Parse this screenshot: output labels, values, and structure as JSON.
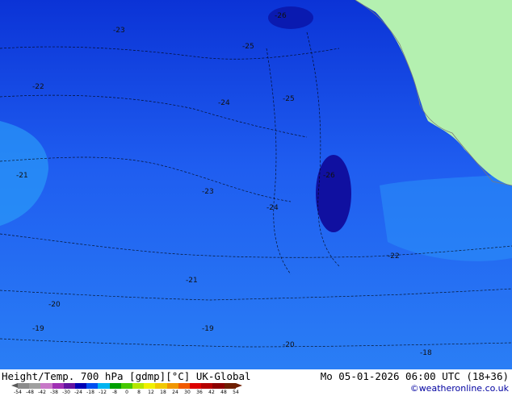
{
  "map": {
    "colors": {
      "sea_dark": "#0a32d8",
      "sea_mid": "#1e5cf0",
      "sea_light": "#2a8ef8",
      "core": "#1010a0",
      "land": "#b4f0b0",
      "contour": "#000000"
    },
    "contour_labels": [
      "-26",
      "-25",
      "-24",
      "-23",
      "-22",
      "-21",
      "-20",
      "-19",
      "-18"
    ]
  },
  "footer": {
    "caption_left": "Height/Temp. 700 hPa [gdmp][°C] UK-Global",
    "caption_right": "Mo 05-01-2026 06:00 UTC (18+36)",
    "credit": "©weatheronline.co.uk",
    "scale_labels": [
      "-54",
      "-48",
      "-42",
      "-38",
      "-30",
      "-24",
      "-18",
      "-12",
      "-8",
      "0",
      "8",
      "12",
      "18",
      "24",
      "30",
      "36",
      "42",
      "48",
      "54"
    ],
    "scale_colors": [
      "#8c8c8c",
      "#a0a0a0",
      "#c878c8",
      "#a030b4",
      "#6414a0",
      "#0000b4",
      "#0050f0",
      "#00b4f0",
      "#00a000",
      "#46c800",
      "#b4e600",
      "#f0f000",
      "#f0c800",
      "#f09600",
      "#f05a00",
      "#dc0000",
      "#b40000",
      "#8c0000",
      "#6e1e00"
    ]
  }
}
